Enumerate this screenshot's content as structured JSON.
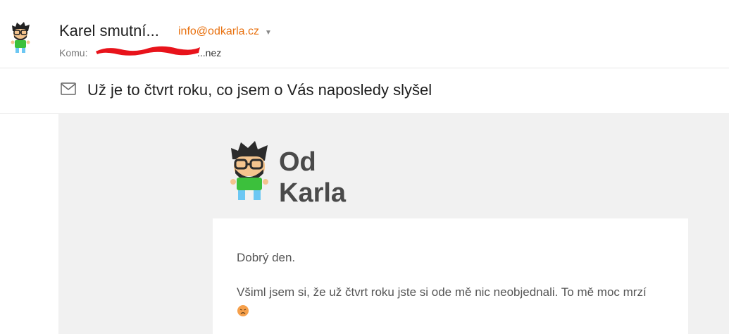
{
  "header": {
    "sender_name": "Karel smutní...",
    "sender_email": "info@odkarla.cz",
    "to_label": "Komu:",
    "to_value_tail": "...nez"
  },
  "subject": "Už je to čtvrt roku, co jsem o Vás naposledy slyšel",
  "logo": {
    "line1": "Od",
    "line2": "Karla"
  },
  "message": {
    "greeting": "Dobrý den.",
    "paragraph": "Všiml jsem si, že už čtvrt roku jste si ode mě nic neobjednali. To mě moc mrzí",
    "emoji": "disappointed-face-icon"
  },
  "colors": {
    "brand_green": "#3cc03c",
    "accent_orange": "#e8700e",
    "redaction_red": "#e8131b"
  }
}
